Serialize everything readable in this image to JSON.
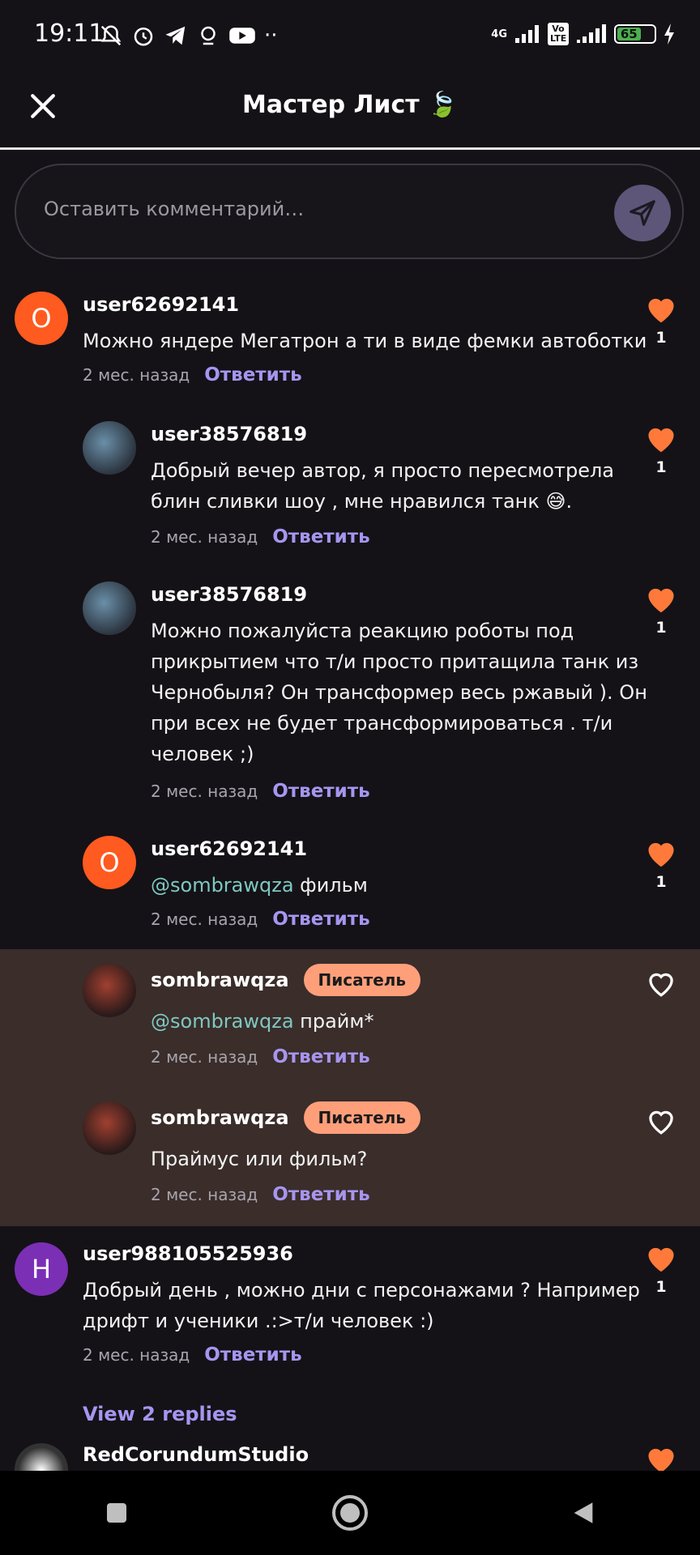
{
  "status_bar": {
    "time": "19:11",
    "network": "4G",
    "volte": "Vo LTE",
    "battery": "65"
  },
  "header": {
    "title": "Мастер Лист",
    "title_emoji": "🍃"
  },
  "comment_input": {
    "placeholder": "Оставить комментарий…"
  },
  "reply_label": "Ответить",
  "comments": [
    {
      "avatar_letter": "O",
      "avatar_color": "#ff5a1f",
      "username": "user62692141",
      "text": "Можно яндере Мегатрон а ти в виде фемки автоботки",
      "time": "2 мес. назад",
      "likes": "1"
    },
    {
      "username": "user38576819",
      "text_line1": "Добрый вечер автор, я просто пересмотрела",
      "text_line2": "блин сливки шоу , мне нравился танк 😅.",
      "time": "2 мес. назад",
      "likes": "1"
    },
    {
      "username": "user38576819",
      "text_lines": [
        "Можно пожалуйста реакцию роботы под",
        "прикрытием что т/и просто притащила танк из",
        "Чернобыля? Он трансформер весь ржавый ). Он",
        "при всех не будет трансформироваться . т/и",
        "человек ;)"
      ],
      "time": "2 мес. назад",
      "likes": "1"
    },
    {
      "avatar_letter": "O",
      "avatar_color": "#ff5a1f",
      "username": "user62692141",
      "mention": "@sombrawqza",
      "text": " фильм",
      "time": "2 мес. назад",
      "likes": "1"
    },
    {
      "username": "sombrawqza",
      "badge": "Писатель",
      "mention": "@sombrawqza",
      "text": " прайм*",
      "time": "2 мес. назад"
    },
    {
      "username": "sombrawqza",
      "badge": "Писатель",
      "text": "Праймус или фильм?",
      "time": "2 мес. назад"
    },
    {
      "avatar_letter": "H",
      "avatar_color": "#7b2fb5",
      "username": "user988105525936",
      "text_line1": "Добрый день , можно дни с персонажами ? Например",
      "text_line2": "дрифт и ученики .:>т/и человек :)",
      "time": "2 мес. назад",
      "likes": "1"
    },
    {
      "username": "RedCorundumStudio"
    }
  ],
  "view_replies": "View 2 replies",
  "colors": {
    "background": "#141217",
    "accent_purple": "#a795f0",
    "heart_orange": "#ff7a3a",
    "highlight_bg": "#3a2d2a",
    "badge_bg": "#ff9f7a"
  }
}
